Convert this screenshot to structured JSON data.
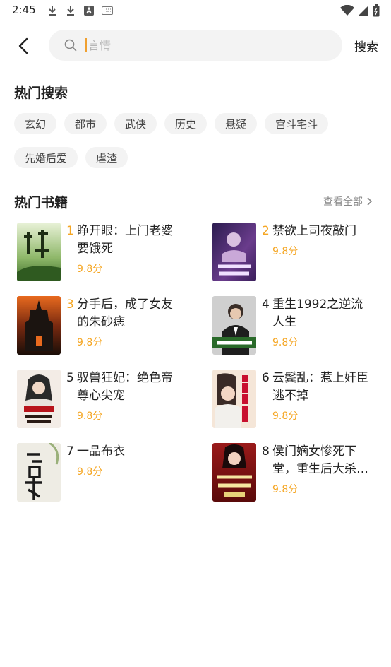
{
  "status_bar": {
    "time": "2:45"
  },
  "search": {
    "placeholder": "言情",
    "button_label": "搜索"
  },
  "hot_search": {
    "title": "热门搜索",
    "tags": [
      "玄幻",
      "都市",
      "武侠",
      "历史",
      "悬疑",
      "宫斗宅斗",
      "先婚后爱",
      "虐渣"
    ]
  },
  "hot_books": {
    "title": "热门书籍",
    "view_all": "查看全部",
    "items": [
      {
        "rank": "1",
        "title": "睁开眼：上门老婆要饿死",
        "score": "9.8分"
      },
      {
        "rank": "2",
        "title": "禁欲上司夜敲门",
        "score": "9.8分"
      },
      {
        "rank": "3",
        "title": "分手后，成了女友的朱砂痣",
        "score": "9.8分"
      },
      {
        "rank": "4",
        "title": "重生1992之逆流人生",
        "score": "9.8分"
      },
      {
        "rank": "5",
        "title": "驭兽狂妃：绝色帝尊心尖宠",
        "score": "9.8分"
      },
      {
        "rank": "6",
        "title": "云鬓乱：惹上奸臣逃不掉",
        "score": "9.8分"
      },
      {
        "rank": "7",
        "title": "一品布衣",
        "score": "9.8分"
      },
      {
        "rank": "8",
        "title": "侯门嫡女惨死下堂，重生后大杀四方",
        "score": "9.8分"
      }
    ]
  },
  "colors": {
    "accent": "#f5a623",
    "tag_bg": "#f3f3f3",
    "search_bg": "#f3f3f3"
  }
}
